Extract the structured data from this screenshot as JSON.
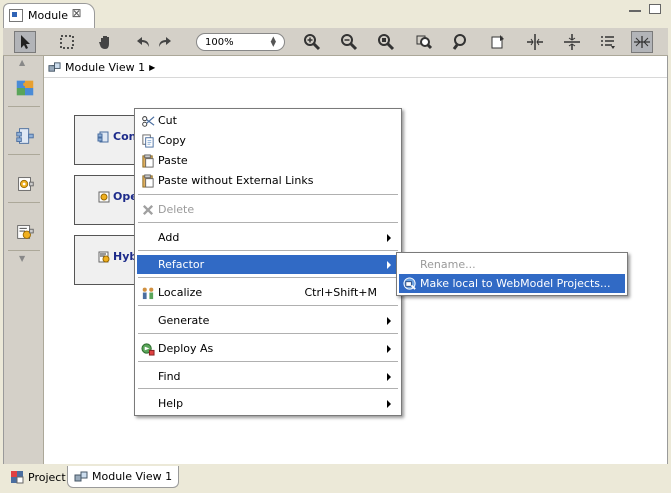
{
  "editor_tab": {
    "label": "Module",
    "close": "⊠"
  },
  "toolbar": {
    "zoom_value": "100%",
    "tools": [
      "select-pointer",
      "marquee-select",
      "pan-hand",
      "undo",
      "redo",
      "zoom-in",
      "zoom-out",
      "zoom-fit",
      "zoom-selection",
      "zoom-custom",
      "add-note",
      "distribute-horizontal",
      "distribute-vertical",
      "list-layout",
      "autolayout"
    ]
  },
  "breadcrumb": {
    "label": "Module View 1"
  },
  "palette": {
    "icons": [
      "puzzle-component-icon",
      "service-component-icon",
      "operation-gear-icon",
      "hybrid-component-icon"
    ]
  },
  "canvas": {
    "nodes": [
      {
        "label": "Con",
        "icon": "component-icon"
      },
      {
        "label": "Ope",
        "icon": "operation-icon"
      },
      {
        "label": "Hyb",
        "icon": "hybrid-icon"
      }
    ]
  },
  "context_menu": {
    "cut": "Cut",
    "copy": "Copy",
    "paste": "Paste",
    "paste_no_links": "Paste without External Links",
    "delete": "Delete",
    "add": "Add",
    "refactor": "Refactor",
    "localize": "Localize",
    "localize_shortcut": "Ctrl+Shift+M",
    "generate": "Generate",
    "deploy_as": "Deploy As",
    "find": "Find",
    "help": "Help"
  },
  "refactor_submenu": {
    "rename": "Rename...",
    "make_local": "Make local to WebModel Projects..."
  },
  "bottom_tabs": {
    "project": "Project",
    "module_view": "Module View 1"
  }
}
